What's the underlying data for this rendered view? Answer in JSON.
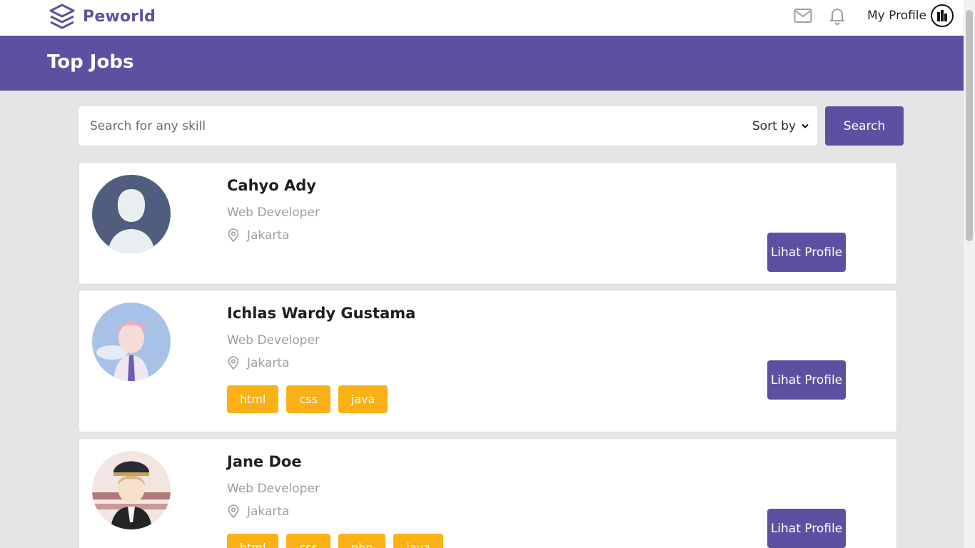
{
  "brand": {
    "name": "Peworld"
  },
  "nav": {
    "profile_label": "My Profile"
  },
  "hero": {
    "title": "Top Jobs"
  },
  "search": {
    "placeholder": "Search for any skill",
    "sort_label": "Sort by",
    "button_label": "Search"
  },
  "cards": [
    {
      "name": "Cahyo Ady",
      "role": "Web Developer",
      "location": "Jakarta",
      "skills": [],
      "button": "Lihat Profile"
    },
    {
      "name": "Ichlas Wardy Gustama",
      "role": "Web Developer",
      "location": "Jakarta",
      "skills": [
        "html",
        "css",
        "java"
      ],
      "button": "Lihat Profile"
    },
    {
      "name": "Jane Doe",
      "role": "Web Developer",
      "location": "Jakarta",
      "skills": [
        "html",
        "css",
        "php",
        "java"
      ],
      "button": "Lihat Profile"
    }
  ],
  "colors": {
    "primary": "#5e50a1",
    "skill": "#fbb017",
    "background": "#e5e5e5"
  }
}
